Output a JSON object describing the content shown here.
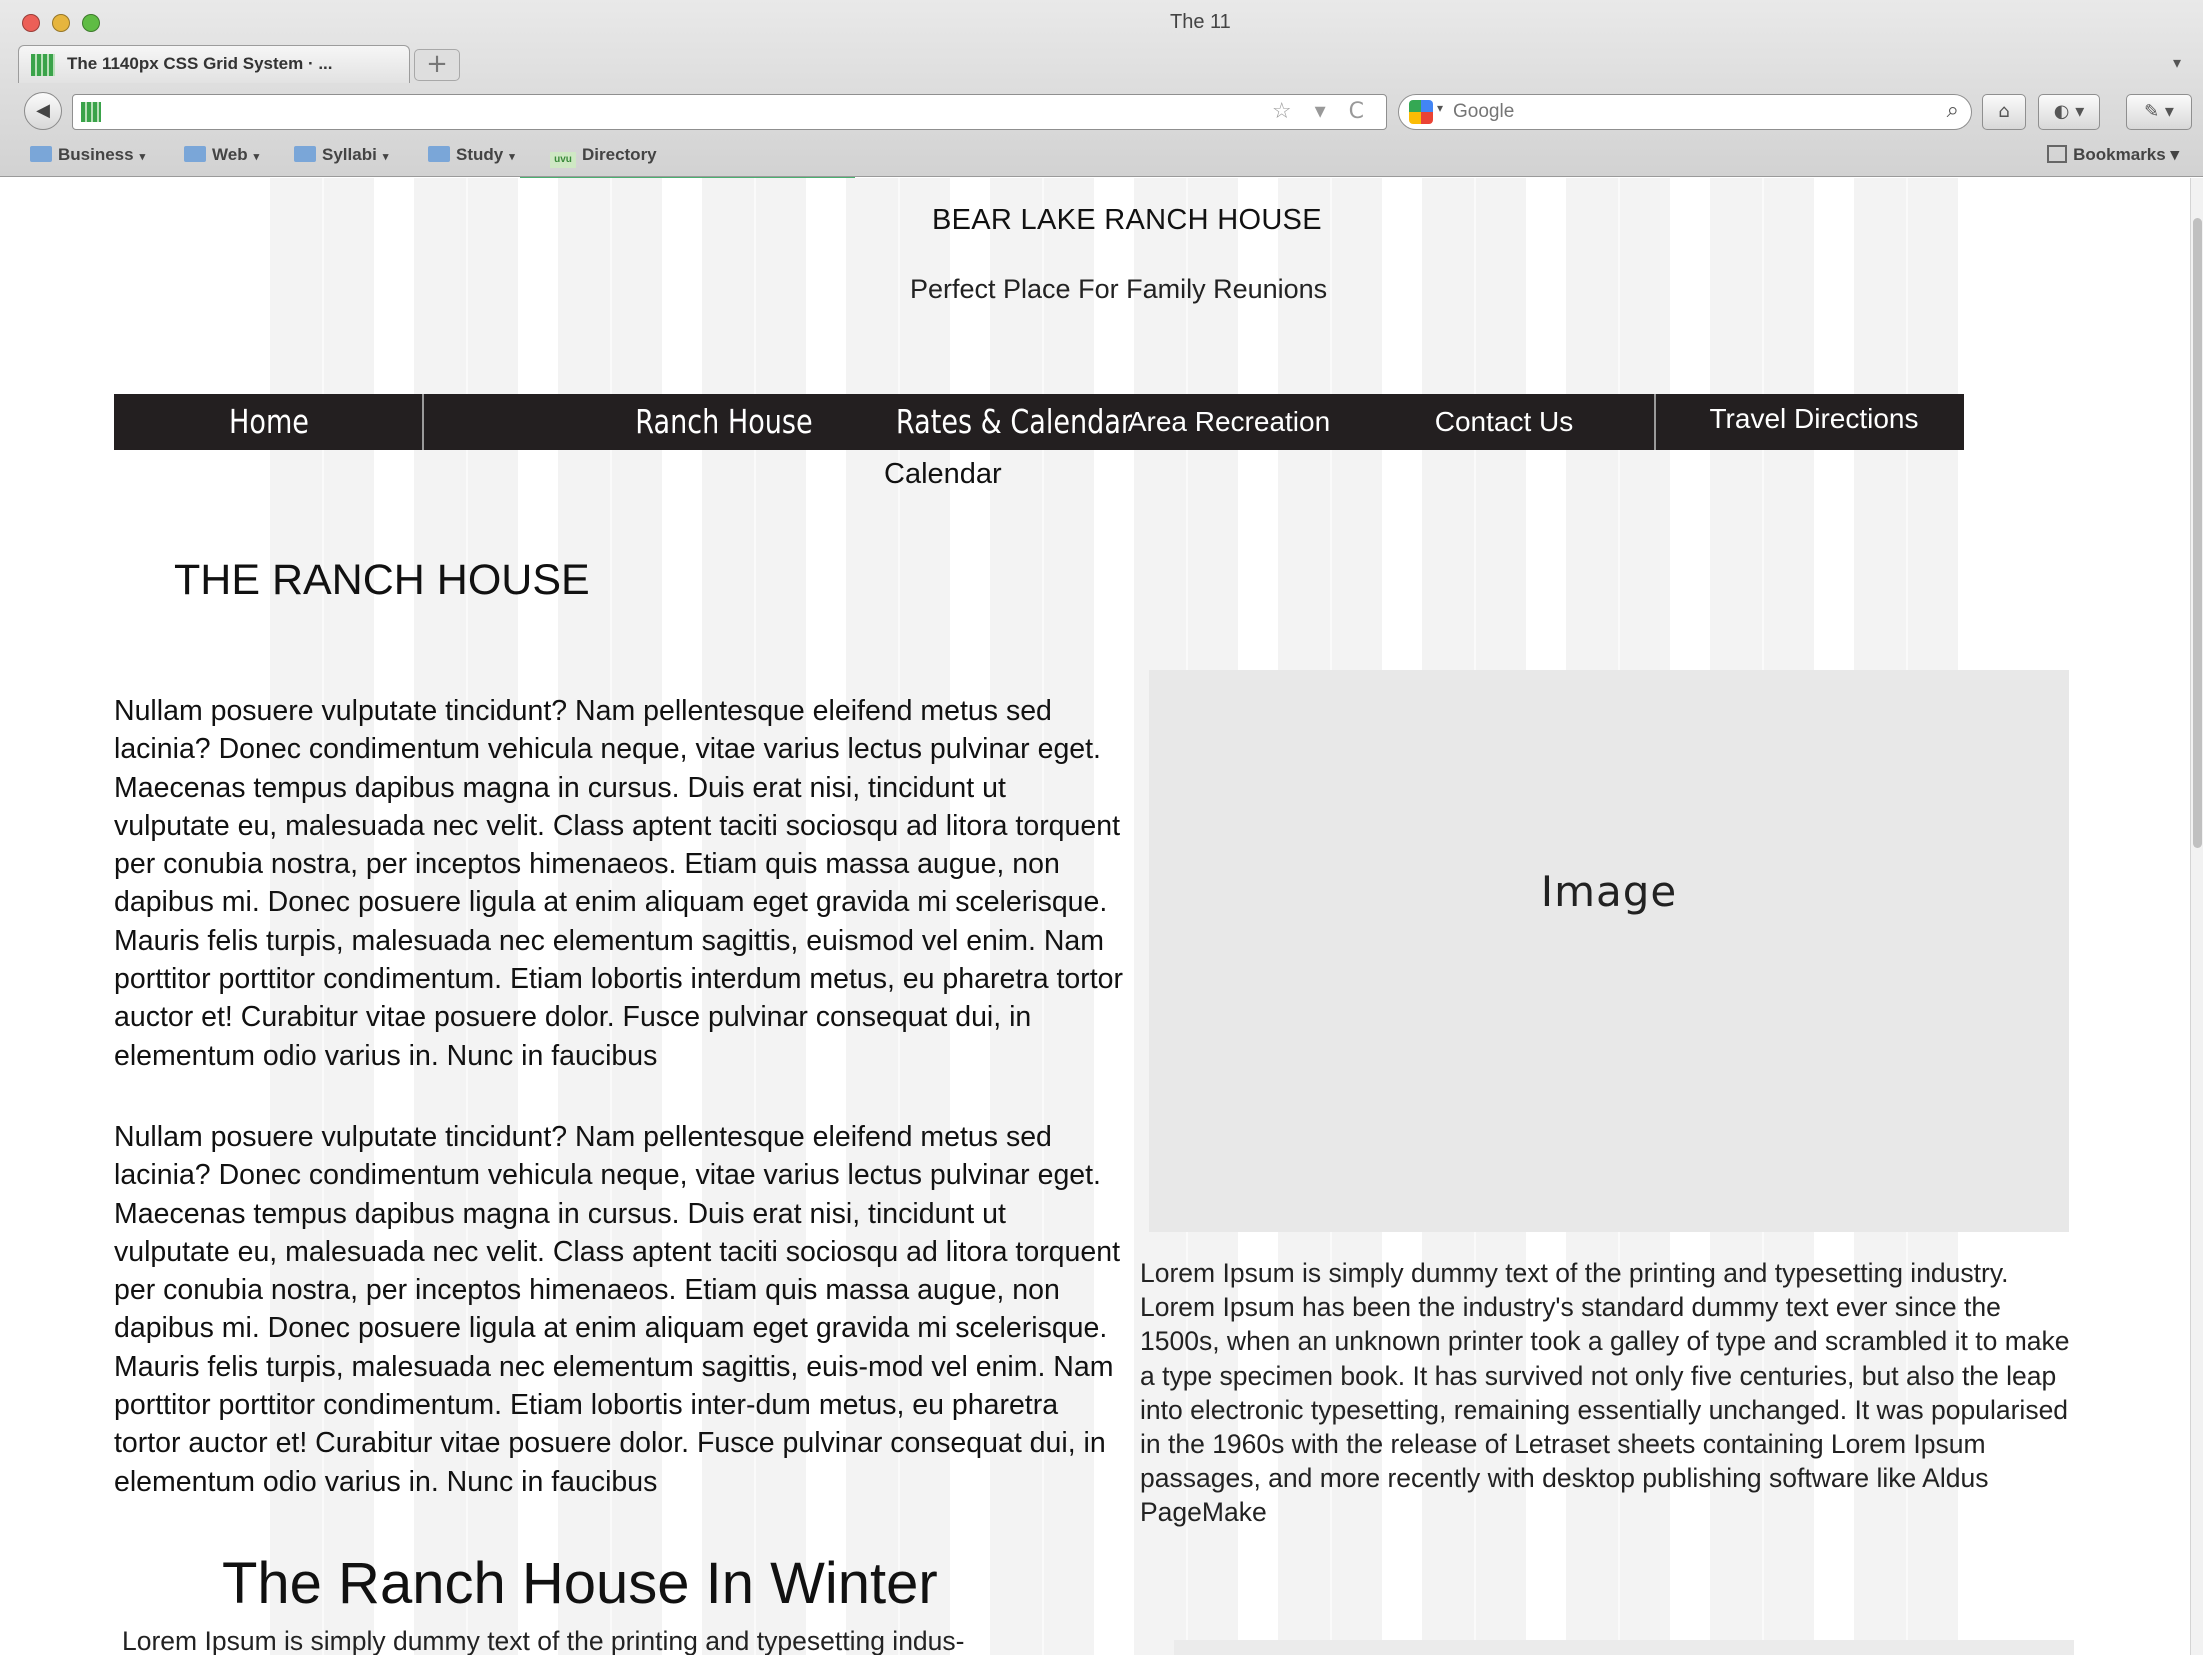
{
  "browser": {
    "window_title": "The 11",
    "tab_title": "The 1140px CSS Grid System · ...",
    "new_tab_symbol": "+",
    "tab_list_symbol": "▾",
    "back_symbol": "◀",
    "url_icons": "☆ ▾ C",
    "search_placeholder": "Google",
    "search_icon": "⌕",
    "home_symbol": "⌂",
    "ext_symbol": "◐ ▾",
    "ext2_symbol": "✎ ▾",
    "bookmarks": [
      {
        "label": "Business"
      },
      {
        "label": "Web"
      },
      {
        "label": "Syllabi"
      },
      {
        "label": "Study"
      }
    ],
    "directory_label": "Directory",
    "directory_favicon": "uvu",
    "bookmarks_menu_label": "Bookmarks"
  },
  "site": {
    "title": "BEAR LAKE RANCH HOUSE",
    "tagline": "Perfect Place For  Family Reunions"
  },
  "nav": {
    "items": [
      {
        "label": "Home"
      },
      {
        "label": "Ranch House"
      },
      {
        "label": "Rates & Calendar"
      },
      {
        "label": "Area Recreation"
      },
      {
        "label": "Contact Us"
      },
      {
        "label": "Travel Directions"
      }
    ],
    "submenu_calendar": "Calendar"
  },
  "main": {
    "heading": "THE RANCH HOUSE",
    "paragraph_1": "Nullam posuere vulputate tincidunt? Nam pellentesque eleifend metus sed lacinia? Donec condimentum vehicula neque, vitae varius lectus pulvinar eget. Maecenas tempus dapibus magna in cursus. Duis erat nisi, tincidunt ut vulputate eu, malesuada nec velit. Class aptent taciti sociosqu ad litora torquent per conubia nostra, per inceptos himenaeos. Etiam quis massa augue, non dapibus mi. Donec posuere ligula at enim aliquam eget gravida mi scelerisque. Mauris felis turpis, malesuada nec elementum sagittis, euismod vel enim. Nam porttitor porttitor condimentum. Etiam lobortis interdum metus, eu pharetra tortor auctor et! Curabitur vitae posuere dolor. Fusce pulvinar consequat dui, in elementum odio varius in. Nunc in faucibus",
    "paragraph_2": "Nullam posuere vulputate tincidunt? Nam pellentesque eleifend metus sed lacinia? Donec condimentum vehicula neque, vitae varius lectus pulvinar eget. Maecenas tempus dapibus magna in cursus. Duis erat nisi, tincidunt ut vulputate eu, malesuada nec velit. Class aptent taciti sociosqu ad litora torquent per conubia nostra, per inceptos himenaeos. Etiam quis massa augue, non dapibus mi. Donec posuere ligula at enim aliquam eget gravida mi scelerisque. Mauris felis turpis, malesuada nec elementum sagittis, euis-mod vel enim. Nam porttitor porttitor condimentum. Etiam lobortis inter-dum metus, eu pharetra tortor auctor et! Curabitur vitae posuere dolor. Fusce pulvinar consequat dui, in elementum odio varius in. Nunc in faucibus",
    "image_placeholder": "Image",
    "image_caption": "Lorem Ipsum is simply dummy text of the printing and typesetting industry. Lorem Ipsum has been the industry's standard dummy text ever since the 1500s, when an unknown printer took a galley of type and scrambled it to make a type specimen book. It has survived not only five centuries, but also the leap into electronic typesetting, remaining essentially unchanged. It was popularised in the 1960s with the release of Letraset sheets containing Lorem Ipsum passages, and more recently with desktop publishing software like Aldus PageMake",
    "winter_heading": "The Ranch House In Winter",
    "winter_text": "Lorem Ipsum is simply dummy text of the printing and typesetting indus-"
  },
  "colors": {
    "nav_background": "#231f20",
    "image_placeholder_bg": "#e8e8e8",
    "tab_accent": "#4bb070"
  }
}
